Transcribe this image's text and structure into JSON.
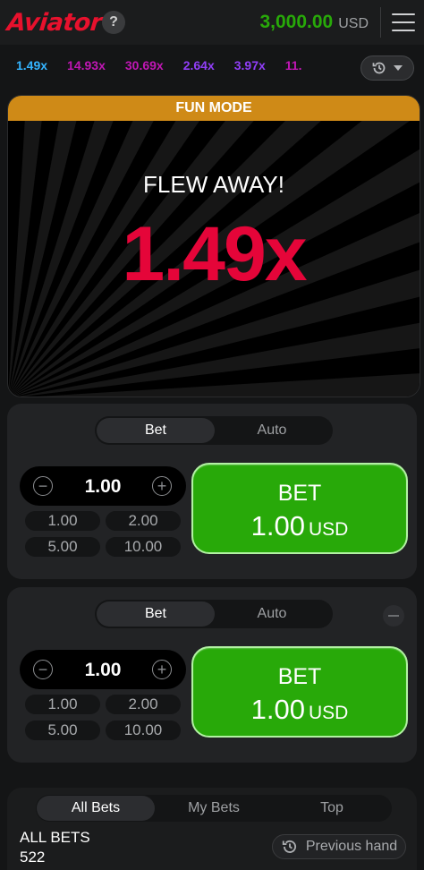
{
  "header": {
    "logo": "Aviator",
    "help": "?",
    "balance_amount": "3,000.00",
    "balance_currency": "USD"
  },
  "history": {
    "items": [
      {
        "value": "1.49x",
        "color": "#34b4ff"
      },
      {
        "value": "14.93x",
        "color": "#c017b4"
      },
      {
        "value": "30.69x",
        "color": "#c017b4"
      },
      {
        "value": "2.64x",
        "color": "#913ef8"
      },
      {
        "value": "3.97x",
        "color": "#913ef8"
      },
      {
        "value": "11.",
        "color": "#c017b4"
      }
    ]
  },
  "game": {
    "mode_banner": "FUN MODE",
    "status": "FLEW AWAY!",
    "multiplier": "1.49x",
    "multiplier_color": "#e50539"
  },
  "bet_panels": [
    {
      "tab_bet": "Bet",
      "tab_auto": "Auto",
      "stake": "1.00",
      "quick": [
        "1.00",
        "2.00",
        "5.00",
        "10.00"
      ],
      "button_line1": "BET",
      "button_amount": "1.00",
      "button_currency": "USD"
    },
    {
      "tab_bet": "Bet",
      "tab_auto": "Auto",
      "stake": "1.00",
      "quick": [
        "1.00",
        "2.00",
        "5.00",
        "10.00"
      ],
      "button_line1": "BET",
      "button_amount": "1.00",
      "button_currency": "USD"
    }
  ],
  "bets": {
    "tabs": [
      "All Bets",
      "My Bets",
      "Top"
    ],
    "title": "ALL BETS",
    "count": "522",
    "previous_hand": "Previous hand"
  },
  "colors": {
    "accent_green": "#28a909",
    "brand_red": "#e8112d",
    "fun_mode_orange": "#cf8a17"
  }
}
